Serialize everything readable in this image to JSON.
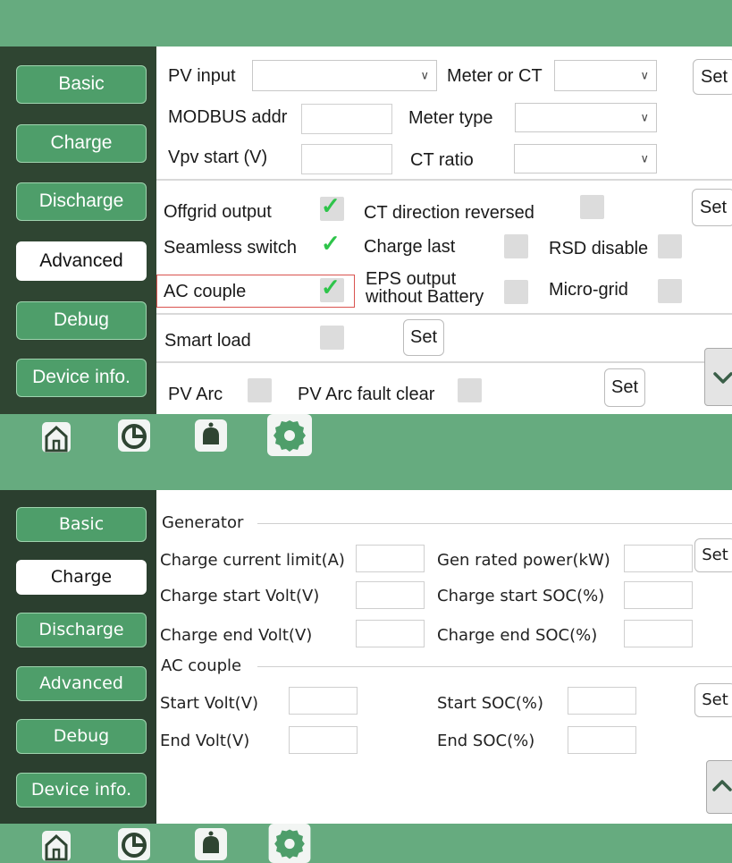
{
  "top_panel": {
    "sidebar": {
      "items": [
        {
          "label": "Basic",
          "active": false
        },
        {
          "label": "Charge",
          "active": false
        },
        {
          "label": "Discharge",
          "active": false
        },
        {
          "label": "Advanced",
          "active": true
        },
        {
          "label": "Debug",
          "active": false
        },
        {
          "label": "Device info.",
          "active": false
        }
      ]
    },
    "section1": {
      "pv_input_label": "PV input",
      "pv_input_value": "",
      "meter_or_ct_label": "Meter or CT",
      "meter_or_ct_value": "",
      "modbus_addr_label": "MODBUS addr",
      "modbus_addr_value": "",
      "meter_type_label": "Meter type",
      "meter_type_value": "",
      "vpv_start_label": "Vpv start (V)",
      "vpv_start_value": "",
      "ct_ratio_label": "CT ratio",
      "ct_ratio_value": "",
      "set_label": "Set"
    },
    "section2": {
      "offgrid_output_label": "Offgrid output",
      "offgrid_output_checked": true,
      "ct_direction_label": "CT direction reversed",
      "ct_direction_checked": false,
      "seamless_switch_label": "Seamless switch",
      "seamless_switch_checked": true,
      "charge_last_label": "Charge last",
      "charge_last_checked": false,
      "rsd_disable_label": "RSD disable",
      "rsd_disable_checked": false,
      "ac_couple_label": "AC couple",
      "ac_couple_checked": true,
      "eps_output_label_1": "EPS output",
      "eps_output_label_2": "without Battery",
      "eps_output_checked": false,
      "micro_grid_label": "Micro-grid",
      "micro_grid_checked": false,
      "set_label": "Set"
    },
    "section3": {
      "smart_load_label": "Smart load",
      "smart_load_checked": false,
      "set_label": "Set"
    },
    "section4": {
      "pv_arc_label": "PV Arc",
      "pv_arc_checked": false,
      "pv_arc_fault_clear_label": "PV Arc fault clear",
      "pv_arc_fault_clear_checked": false,
      "set_label": "Set"
    },
    "scroll_down_icon": "chevron-down-icon"
  },
  "bottom_panel": {
    "sidebar": {
      "items": [
        {
          "label": "Basic",
          "active": false
        },
        {
          "label": "Charge",
          "active": true
        },
        {
          "label": "Discharge",
          "active": false
        },
        {
          "label": "Advanced",
          "active": false
        },
        {
          "label": "Debug",
          "active": false
        },
        {
          "label": "Device info.",
          "active": false
        }
      ]
    },
    "generator": {
      "title": "Generator",
      "charge_current_limit_label": "Charge current limit(A)",
      "charge_current_limit_value": "",
      "gen_rated_power_label": "Gen rated power(kW)",
      "gen_rated_power_value": "",
      "charge_start_volt_label": "Charge start Volt(V)",
      "charge_start_volt_value": "",
      "charge_start_soc_label": "Charge start SOC(%)",
      "charge_start_soc_value": "",
      "charge_end_volt_label": "Charge end Volt(V)",
      "charge_end_volt_value": "",
      "charge_end_soc_label": "Charge end SOC(%)",
      "charge_end_soc_value": "",
      "set_label": "Set"
    },
    "ac_couple": {
      "title": "AC couple",
      "start_volt_label": "Start Volt(V)",
      "start_volt_value": "",
      "start_soc_label": "Start SOC(%)",
      "start_soc_value": "",
      "end_volt_label": "End Volt(V)",
      "end_volt_value": "",
      "end_soc_label": "End SOC(%)",
      "end_soc_value": "",
      "set_label": "Set"
    },
    "scroll_up_icon": "chevron-up-icon"
  },
  "bottom_nav": {
    "icons": [
      "home-icon",
      "chart-icon",
      "bell-icon",
      "settings-icon"
    ],
    "active": "settings-icon"
  },
  "colors": {
    "bar_green": "#66ab7f",
    "sidebar_dark": "#2f4532",
    "nav_button_green": "#4e9e6a",
    "check_green": "#2ec44a",
    "highlight_red": "#d9534f"
  }
}
